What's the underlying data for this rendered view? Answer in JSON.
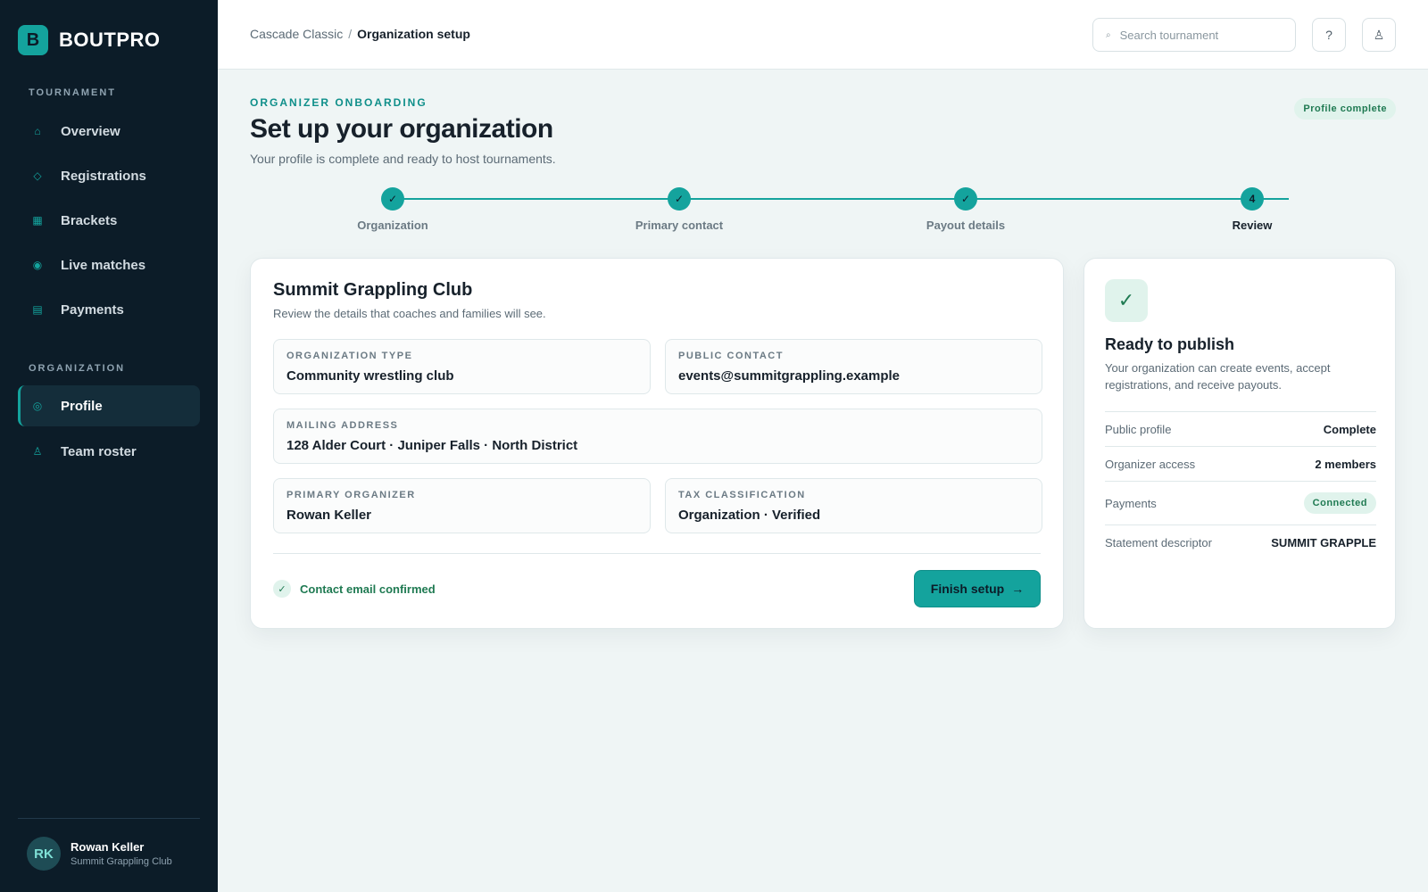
{
  "brand": {
    "mark": "B",
    "name": "BOUTPRO"
  },
  "sidebar": {
    "sections": [
      {
        "title": "TOURNAMENT"
      },
      {
        "title": "ORGANIZATION"
      }
    ],
    "items": [
      {
        "label": "Overview",
        "icon": "home-icon",
        "glyph": "⌂"
      },
      {
        "label": "Registrations",
        "icon": "diamond-icon",
        "glyph": "◇"
      },
      {
        "label": "Brackets",
        "icon": "grid-icon",
        "glyph": "▦"
      },
      {
        "label": "Live matches",
        "icon": "live-dot-icon",
        "glyph": "◉"
      },
      {
        "label": "Payments",
        "icon": "payments-icon",
        "glyph": "▤"
      },
      {
        "label": "Profile",
        "icon": "profile-icon",
        "glyph": "◎",
        "active": true
      },
      {
        "label": "Team roster",
        "icon": "user-icon",
        "glyph": "♙"
      }
    ],
    "user": {
      "initials": "RK",
      "name": "Rowan Keller",
      "org": "Summit Grappling Club"
    }
  },
  "topbar": {
    "breadcrumb": {
      "parent": "Cascade Classic",
      "separator": "/",
      "current": "Organization setup"
    },
    "search": {
      "placeholder": "Search tournament",
      "icon_glyph": "⌕"
    },
    "help_glyph": "?",
    "account_glyph": "♙"
  },
  "header": {
    "eyebrow": "ORGANIZER ONBOARDING",
    "title": "Set up your organization",
    "subtitle": "Your profile is complete and ready to host tournaments.",
    "badge": "Profile complete"
  },
  "stepper": {
    "steps": [
      {
        "label": "Organization",
        "marker": "✓",
        "status": "done"
      },
      {
        "label": "Primary contact",
        "marker": "✓",
        "status": "done"
      },
      {
        "label": "Payout details",
        "marker": "✓",
        "status": "done"
      },
      {
        "label": "Review",
        "marker": "4",
        "status": "current"
      }
    ]
  },
  "main_card": {
    "title": "Summit Grappling Club",
    "subtitle": "Review the details that coaches and families will see.",
    "fields": {
      "org_type": {
        "label": "ORGANIZATION TYPE",
        "value": "Community wrestling club"
      },
      "public_contact": {
        "label": "PUBLIC CONTACT",
        "value": "events@summitgrappling.example"
      },
      "mailing_address": {
        "label": "MAILING ADDRESS",
        "value": "128 Alder Court · Juniper Falls · North District"
      },
      "primary_organizer": {
        "label": "PRIMARY ORGANIZER",
        "value": "Rowan Keller"
      },
      "tax_classification": {
        "label": "TAX CLASSIFICATION",
        "value": "Organization · Verified"
      }
    },
    "confirmation": {
      "glyph": "✓",
      "text": "Contact email confirmed"
    },
    "finish_button": {
      "label": "Finish setup",
      "arrow": "→"
    }
  },
  "side_card": {
    "icon_glyph": "✓",
    "title": "Ready to publish",
    "description": "Your organization can create events, accept registrations, and receive payouts.",
    "rows": [
      {
        "key": "Public profile",
        "value": "Complete"
      },
      {
        "key": "Organizer access",
        "value": "2 members"
      },
      {
        "key": "Payments",
        "value": "Connected"
      },
      {
        "key": "Statement descriptor",
        "value": "SUMMIT GRAPPLE"
      }
    ]
  },
  "colors": {
    "accent": "#14a39d",
    "sidebar_bg": "#0c1c28",
    "success": "#1f7a52",
    "success_bg": "#e0f3ec",
    "page_bg": "#eff5f5"
  }
}
